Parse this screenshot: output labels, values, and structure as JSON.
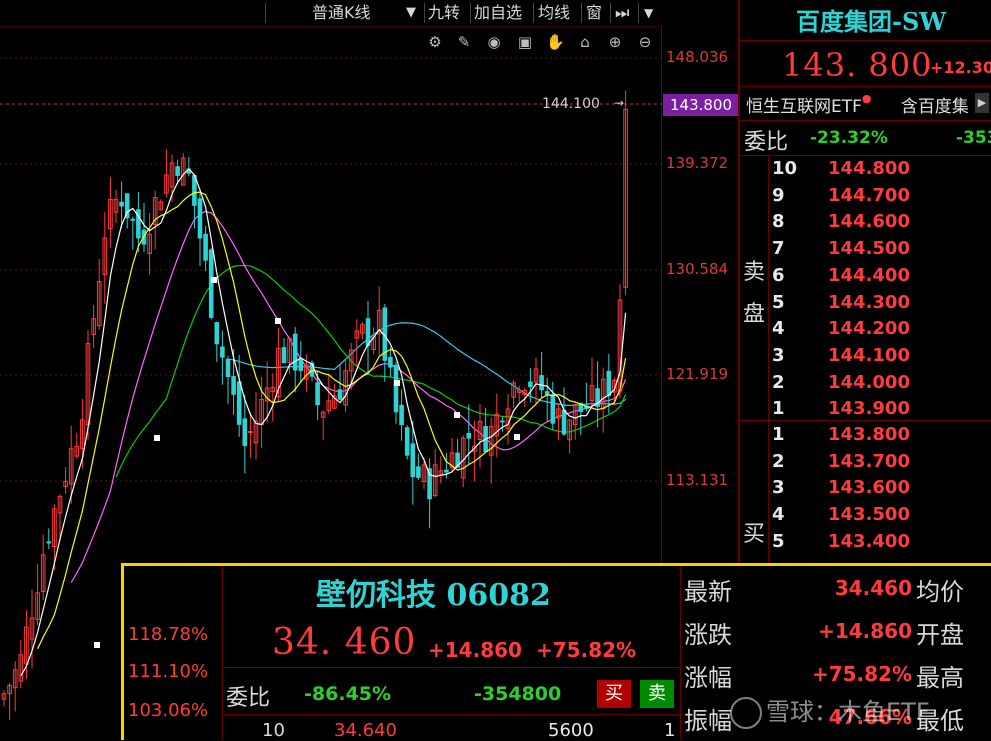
{
  "toolbar": {
    "kline_type": "普通K线",
    "nine_turn": "九转",
    "add_watch": "加自选",
    "ma": "均线",
    "window": "窗"
  },
  "chart": {
    "y_ticks": [
      "148.036",
      "139.372",
      "130.584",
      "121.919",
      "113.131"
    ],
    "last_price_label": "143.800",
    "high_marker_label": "144.100"
  },
  "right_panel": {
    "title": "百度集团-SW",
    "price": "143. 800",
    "change": "+12.30",
    "etf_label": "恒生互联网ETF",
    "etf_label_right": "含百度集",
    "weibi_label": "委比",
    "weibi_value": "-23.32%",
    "weibi_count": "-353",
    "sell_side_label": "卖盘",
    "buy_side_label": "买",
    "asks": [
      {
        "level": "10",
        "price": "144.800"
      },
      {
        "level": "9",
        "price": "144.700"
      },
      {
        "level": "8",
        "price": "144.600"
      },
      {
        "level": "7",
        "price": "144.500"
      },
      {
        "level": "6",
        "price": "144.400"
      },
      {
        "level": "5",
        "price": "144.300"
      },
      {
        "level": "4",
        "price": "144.200"
      },
      {
        "level": "3",
        "price": "144.100"
      },
      {
        "level": "2",
        "price": "144.000"
      },
      {
        "level": "1",
        "price": "143.900"
      }
    ],
    "bids": [
      {
        "level": "1",
        "price": "143.800"
      },
      {
        "level": "2",
        "price": "143.700"
      },
      {
        "level": "3",
        "price": "143.600"
      },
      {
        "level": "4",
        "price": "143.500"
      },
      {
        "level": "5",
        "price": "143.400"
      }
    ]
  },
  "popup": {
    "name": "壁仞科技 06082",
    "price": "34. 460",
    "change": "+14.860",
    "change_pct": "+75.82%",
    "pct_ticks": [
      "118.78%",
      "111.10%",
      "103.06%"
    ],
    "weibi_label": "委比",
    "weibi_value": "-86.45%",
    "weibi_count": "-354800",
    "buy_button": "买",
    "sell_button": "卖",
    "row10_level": "10",
    "row10_price": "34.640",
    "row10_vol": "5600",
    "row10_count": "1",
    "stats": [
      {
        "label": "最新",
        "value": "34.460",
        "label2": "均价"
      },
      {
        "label": "涨跌",
        "value": "+14.860",
        "label2": "开盘"
      },
      {
        "label": "涨幅",
        "value": "+75.82%",
        "label2": "最高"
      },
      {
        "label": "振幅",
        "value": "47.66%",
        "label2": "最低"
      }
    ],
    "watermark": "雪球：木鱼ETF"
  },
  "colors": {
    "up": "#ff3b3b",
    "down": "#2fd3d3",
    "ma5": "#ffffff",
    "ma10": "#ffff00",
    "ma20": "#ff66ff",
    "ma30": "#00d000",
    "ma60": "#33ccee",
    "title": "#2fd3d3",
    "border": "#ffd000"
  }
}
